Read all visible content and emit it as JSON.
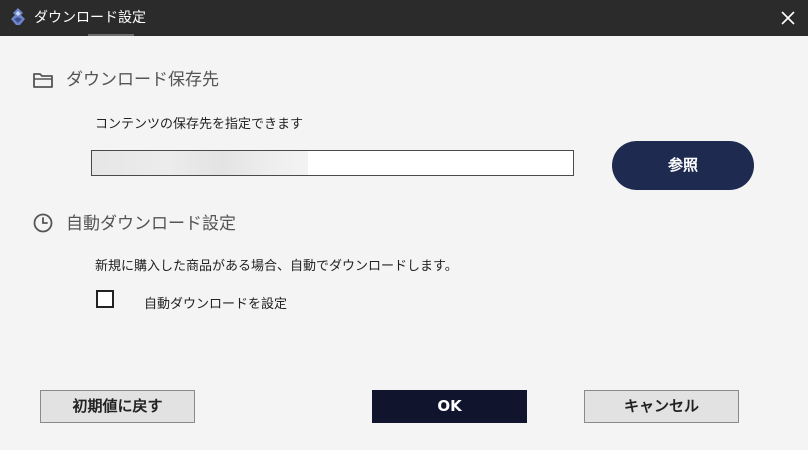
{
  "window": {
    "title": "ダウンロード設定",
    "icons": {
      "app": "app-logo-icon",
      "close": "close-icon"
    }
  },
  "download_location": {
    "heading": "ダウンロード保存先",
    "icon": "folder-icon",
    "description": "コンテンツの保存先を指定できます",
    "path_value": "",
    "browse_label": "参照"
  },
  "auto_download": {
    "heading": "自動ダウンロード設定",
    "icon": "clock-icon",
    "description": "新規に購入した商品がある場合、自動でダウンロードします。",
    "checkbox_label": "自動ダウンロードを設定",
    "checked": false
  },
  "buttons": {
    "reset_label": "初期値に戻す",
    "ok_label": "OK",
    "cancel_label": "キャンセル"
  },
  "colors": {
    "titlebar": "#2b2b2b",
    "accent_button": "#1e2a4f",
    "ok_button": "#10152d",
    "background": "#f4f4f4"
  }
}
